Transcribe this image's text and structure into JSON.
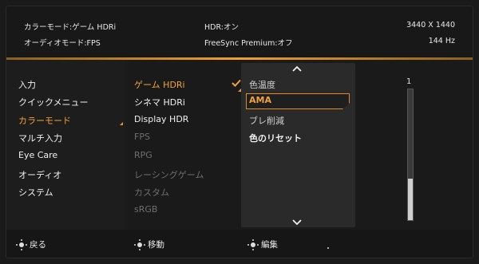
{
  "info": {
    "color_mode": "カラーモード:ゲーム HDRi",
    "audio_mode": "オーディオモード:FPS",
    "hdr": "HDR:オン",
    "freesync": "FreeSync Premium:オフ",
    "resolution": "3440 X 1440",
    "refresh": "144 Hz"
  },
  "main_menu": [
    "入力",
    "クイックメニュー",
    "カラーモード",
    "マルチ入力",
    "Eye Care",
    "オーディオ",
    "システム"
  ],
  "color_modes": [
    "ゲーム HDRi",
    "シネマ HDRi",
    "Display HDR",
    "FPS",
    "RPG",
    "レーシングゲーム",
    "カスタム",
    "sRGB"
  ],
  "sub_options": [
    "色温度",
    "AMA",
    "ブレ削減",
    "色のリセット"
  ],
  "slider": {
    "value": "1",
    "level": 0.33
  },
  "footer": {
    "back": "戻る",
    "move": "移動",
    "edit": "編集"
  },
  "colors": {
    "accent": "#f2a23a",
    "highlight_border": "#e08a28"
  },
  "icons": [
    "check-icon",
    "chevron-up-icon",
    "chevron-down-icon",
    "joystick-icon"
  ]
}
